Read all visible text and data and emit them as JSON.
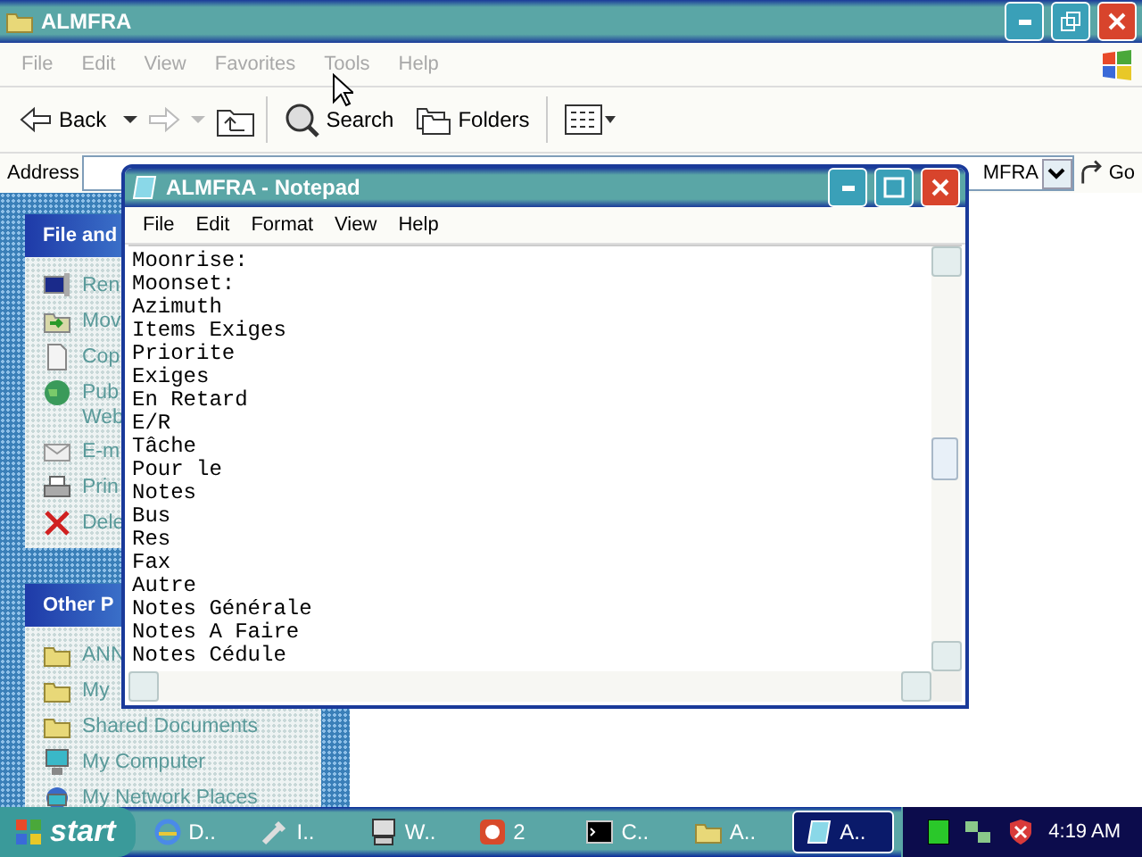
{
  "explorer": {
    "title": "ALMFRA",
    "menu": [
      "File",
      "Edit",
      "View",
      "Favorites",
      "Tools",
      "Help"
    ],
    "toolbar": {
      "back": "Back",
      "search": "Search",
      "folders": "Folders"
    },
    "address": {
      "label": "Address",
      "value": "MFRA",
      "go": "Go"
    },
    "sidebar": [
      {
        "title": "File and",
        "items": [
          {
            "kind": "rename",
            "label": "Ren"
          },
          {
            "kind": "move",
            "label": "Mov"
          },
          {
            "kind": "copy",
            "label": "Cop"
          },
          {
            "kind": "publish",
            "label": "Pub\nWeb"
          },
          {
            "kind": "email",
            "label": "E-m"
          },
          {
            "kind": "print",
            "label": "Prin"
          },
          {
            "kind": "delete",
            "label": "Dele"
          }
        ]
      },
      {
        "title": "Other P",
        "items": [
          {
            "kind": "folder",
            "label": "ANN"
          },
          {
            "kind": "folder",
            "label": "My"
          },
          {
            "kind": "folder",
            "label": "Shared Documents"
          },
          {
            "kind": "computer",
            "label": "My Computer"
          },
          {
            "kind": "network",
            "label": "My Network Places"
          }
        ]
      }
    ]
  },
  "notepad": {
    "title": "ALMFRA - Notepad",
    "menu": [
      "File",
      "Edit",
      "Format",
      "View",
      "Help"
    ],
    "lines": [
      "Moonrise:",
      "Moonset:",
      "Azimuth",
      "Items Exiges",
      "Priorite",
      "Exiges",
      "En Retard",
      "E/R",
      "Tâche",
      "Pour le",
      "Notes",
      "Bus",
      "Res",
      "Fax",
      "Autre",
      "Notes Générale",
      "Notes A Faire",
      "Notes Cédule"
    ]
  },
  "taskbar": {
    "start": "start",
    "tasks": [
      {
        "kind": "browser",
        "label": "D..",
        "selected": false
      },
      {
        "kind": "tool",
        "label": "I..",
        "selected": false
      },
      {
        "kind": "computer",
        "label": "W..",
        "selected": false
      },
      {
        "kind": "group",
        "label": "2",
        "selected": false
      },
      {
        "kind": "console",
        "label": "C..",
        "selected": false
      },
      {
        "kind": "folder",
        "label": "A..",
        "selected": false
      },
      {
        "kind": "notepad",
        "label": "A..",
        "selected": true
      }
    ],
    "clock": "4:19 AM"
  }
}
